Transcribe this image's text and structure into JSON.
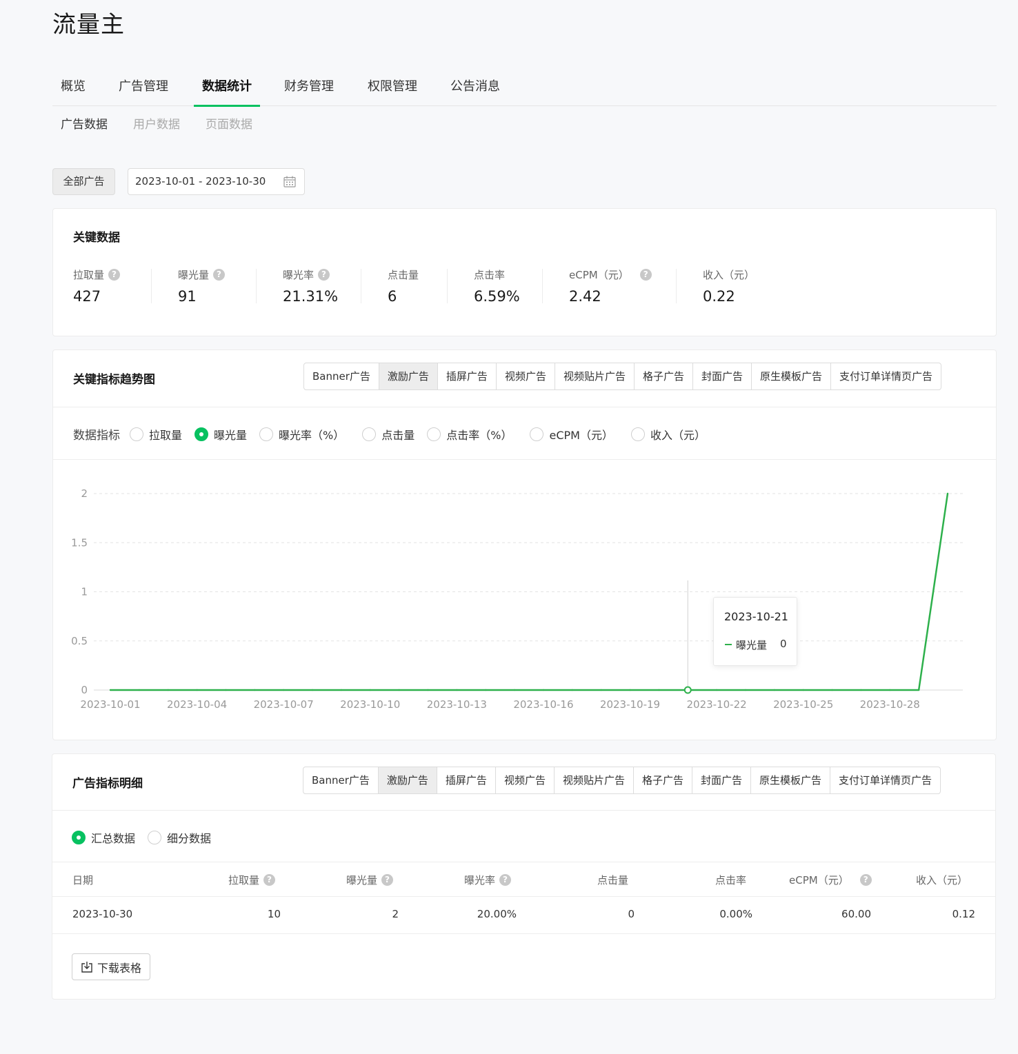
{
  "app": {
    "title": "流量主"
  },
  "main_tabs": [
    {
      "label": "概览"
    },
    {
      "label": "广告管理"
    },
    {
      "label": "数据统计",
      "active": true
    },
    {
      "label": "财务管理"
    },
    {
      "label": "权限管理"
    },
    {
      "label": "公告消息"
    }
  ],
  "sub_tabs": [
    {
      "label": "广告数据",
      "active": true
    },
    {
      "label": "用户数据"
    },
    {
      "label": "页面数据"
    }
  ],
  "filters": {
    "ad_type_button": "全部广告",
    "date_range": "2023-10-01 - 2023-10-30"
  },
  "key_data": {
    "title": "关键数据",
    "metrics": [
      {
        "label": "拉取量",
        "value": "427",
        "help": true
      },
      {
        "label": "曝光量",
        "value": "91",
        "help": true
      },
      {
        "label": "曝光率",
        "value": "21.31%",
        "help": true
      },
      {
        "label": "点击量",
        "value": "6",
        "help": false
      },
      {
        "label": "点击率",
        "value": "6.59%",
        "help": false
      },
      {
        "label": "eCPM（元）",
        "value": "2.42",
        "help": true
      },
      {
        "label": "收入（元）",
        "value": "0.22",
        "help": false
      }
    ]
  },
  "ad_type_tabs": [
    {
      "label": "Banner广告"
    },
    {
      "label": "激励广告",
      "active": true
    },
    {
      "label": "插屏广告"
    },
    {
      "label": "视频广告"
    },
    {
      "label": "视频贴片广告"
    },
    {
      "label": "格子广告"
    },
    {
      "label": "封面广告"
    },
    {
      "label": "原生模板广告"
    },
    {
      "label": "支付订单详情页广告"
    }
  ],
  "trend": {
    "title": "关键指标趋势图",
    "metric_label": "数据指标",
    "metrics": [
      {
        "label": "拉取量"
      },
      {
        "label": "曝光量",
        "checked": true
      },
      {
        "label": "曝光率（%）"
      },
      {
        "label": "点击量"
      },
      {
        "label": "点击率（%）"
      },
      {
        "label": "eCPM（元）"
      },
      {
        "label": "收入（元）"
      }
    ],
    "tooltip": {
      "date": "2023-10-21",
      "series": "曝光量",
      "value": "0"
    }
  },
  "chart_data": {
    "type": "line",
    "series": [
      {
        "name": "曝光量",
        "values": [
          0,
          0,
          0,
          0,
          0,
          0,
          0,
          0,
          0,
          0,
          0,
          0,
          0,
          0,
          0,
          0,
          0,
          0,
          0,
          0,
          0,
          0,
          0,
          0,
          0,
          0,
          0,
          0,
          0,
          2
        ]
      }
    ],
    "x": [
      "2023-10-01",
      "2023-10-02",
      "2023-10-03",
      "2023-10-04",
      "2023-10-05",
      "2023-10-06",
      "2023-10-07",
      "2023-10-08",
      "2023-10-09",
      "2023-10-10",
      "2023-10-11",
      "2023-10-12",
      "2023-10-13",
      "2023-10-14",
      "2023-10-15",
      "2023-10-16",
      "2023-10-17",
      "2023-10-18",
      "2023-10-19",
      "2023-10-20",
      "2023-10-21",
      "2023-10-22",
      "2023-10-23",
      "2023-10-24",
      "2023-10-25",
      "2023-10-26",
      "2023-10-27",
      "2023-10-28",
      "2023-10-29",
      "2023-10-30"
    ],
    "x_tick_labels": [
      "2023-10-01",
      "2023-10-04",
      "2023-10-07",
      "2023-10-10",
      "2023-10-13",
      "2023-10-16",
      "2023-10-19",
      "2023-10-22",
      "2023-10-25",
      "2023-10-28"
    ],
    "y_tick_labels": [
      "0",
      "0.5",
      "1",
      "1.5",
      "2"
    ],
    "ylim": [
      0,
      2
    ],
    "grid": true,
    "highlight_index": 20,
    "color": "#2db04b"
  },
  "detail": {
    "title": "广告指标明细",
    "modes": [
      {
        "label": "汇总数据",
        "checked": true
      },
      {
        "label": "细分数据"
      }
    ],
    "columns": [
      {
        "label": "日期",
        "help": false
      },
      {
        "label": "拉取量",
        "help": true
      },
      {
        "label": "曝光量",
        "help": true
      },
      {
        "label": "曝光率",
        "help": true
      },
      {
        "label": "点击量",
        "help": false
      },
      {
        "label": "点击率",
        "help": false
      },
      {
        "label": "eCPM（元）",
        "help": true
      },
      {
        "label": "收入（元）",
        "help": false
      }
    ],
    "rows": [
      [
        "2023-10-30",
        "10",
        "2",
        "20.00%",
        "0",
        "0.00%",
        "60.00",
        "0.12"
      ]
    ],
    "download_label": "下载表格"
  }
}
